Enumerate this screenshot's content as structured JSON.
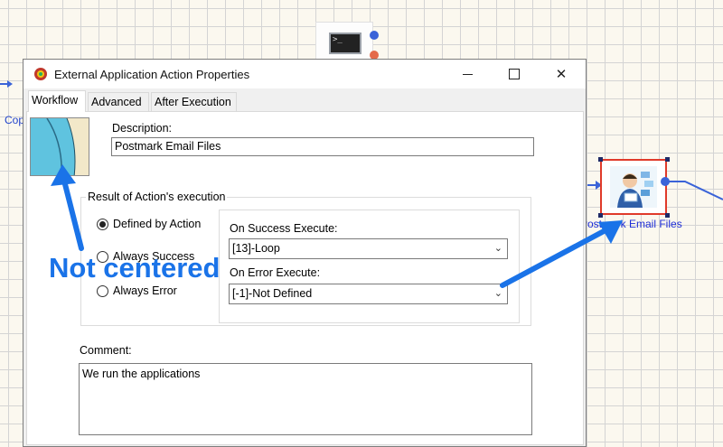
{
  "canvas": {
    "left_label": "Cop",
    "node_label": "Postmark Email Files",
    "cmd_prompt": ">_"
  },
  "dialog": {
    "title": "External Application Action Properties",
    "tabs": [
      {
        "label": "Workflow",
        "active": true
      },
      {
        "label": "Advanced",
        "active": false
      },
      {
        "label": "After Execution",
        "active": false
      }
    ],
    "description_label": "Description:",
    "description_value": "Postmark Email Files",
    "result_group_label": "Result of Action's execution",
    "radios": [
      {
        "label": "Defined by  Action",
        "checked": true
      },
      {
        "label": "Always Success",
        "checked": false
      },
      {
        "label": "Always Error",
        "checked": false
      }
    ],
    "on_success_label": "On Success Execute:",
    "on_success_value": "[13]-Loop",
    "on_error_label": "On Error Execute:",
    "on_error_value": "[-1]-Not Defined",
    "comment_label": "Comment:",
    "comment_value": "We run the applications"
  },
  "annotation": {
    "text": "Not centered",
    "color": "#1a73e8"
  },
  "colors": {
    "node_border": "#e03a2a",
    "node_label": "#1b2bd6",
    "connector": "#3a63d8"
  }
}
